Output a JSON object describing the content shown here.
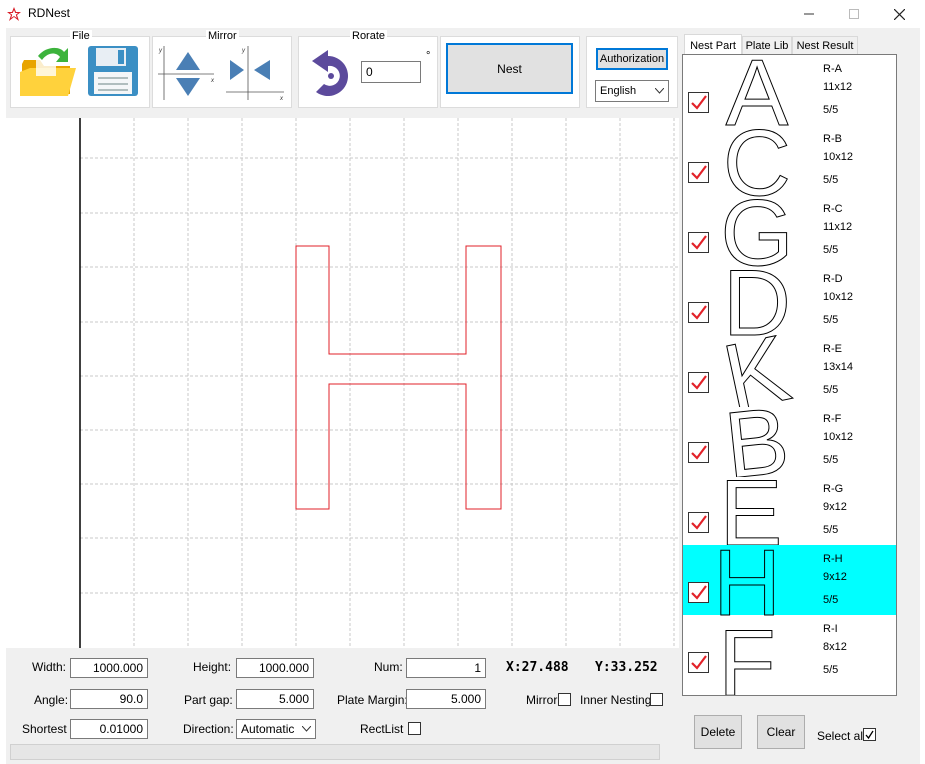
{
  "window": {
    "title": "RDNest"
  },
  "toolbar": {
    "file_label": "File",
    "mirror_label": "Mirror",
    "rotate_label": "Rorate",
    "rotate_value": "0",
    "degree_symbol": "°",
    "nest_label": "Nest",
    "authorization_label": "Authorization",
    "language_value": "English"
  },
  "tabs": [
    {
      "label": "Nest Part",
      "active": true
    },
    {
      "label": "Plate Lib",
      "active": false
    },
    {
      "label": "Nest Result",
      "active": false
    }
  ],
  "parts": [
    {
      "name": "R-A",
      "size": "11x12",
      "count": "5/5",
      "glyph": "A",
      "checked": true,
      "selected": false
    },
    {
      "name": "R-B",
      "size": "10x12",
      "count": "5/5",
      "glyph": "C",
      "checked": true,
      "selected": false
    },
    {
      "name": "R-C",
      "size": "11x12",
      "count": "5/5",
      "glyph": "G",
      "checked": true,
      "selected": false
    },
    {
      "name": "R-D",
      "size": "10x12",
      "count": "5/5",
      "glyph": "D",
      "checked": true,
      "selected": false
    },
    {
      "name": "R-E",
      "size": "13x14",
      "count": "5/5",
      "glyph": "K",
      "checked": true,
      "selected": false
    },
    {
      "name": "R-F",
      "size": "10x12",
      "count": "5/5",
      "glyph": "B",
      "checked": true,
      "selected": false
    },
    {
      "name": "R-G",
      "size": "9x12",
      "count": "5/5",
      "glyph": "E",
      "checked": true,
      "selected": false
    },
    {
      "name": "R-H",
      "size": "9x12",
      "count": "5/5",
      "glyph": "H",
      "checked": true,
      "selected": true
    },
    {
      "name": "R-I",
      "size": "8x12",
      "count": "5/5",
      "glyph": "F",
      "checked": true,
      "selected": false
    }
  ],
  "params": {
    "width_label": "Width:",
    "width_value": "1000.000",
    "height_label": "Height:",
    "height_value": "1000.000",
    "num_label": "Num:",
    "num_value": "1",
    "angle_label": "Angle:",
    "angle_value": "90.0",
    "partgap_label": "Part gap:",
    "partgap_value": "5.000",
    "platemargin_label": "Plate Margin:",
    "platemargin_value": "5.000",
    "shortest_label": "Shortest",
    "shortest_value": "0.01000",
    "direction_label": "Direction:",
    "direction_value": "Automatic",
    "rectlist_label": "RectList",
    "mirror_label": "Mirror",
    "innernesting_label": "Inner Nesting",
    "x_coord": "X:27.488",
    "y_coord": "Y:33.252"
  },
  "actions": {
    "delete_label": "Delete",
    "clear_label": "Clear",
    "selectall_label": "Select all"
  },
  "colors": {
    "shape": "#e0202a",
    "selected_row": "#00ffff",
    "check_mark": "#e32229",
    "accent": "#0078d7"
  },
  "icons": [
    "open-folder-icon",
    "save-disk-icon",
    "mirror-vertical-icon",
    "mirror-horizontal-icon",
    "rotate-icon"
  ]
}
